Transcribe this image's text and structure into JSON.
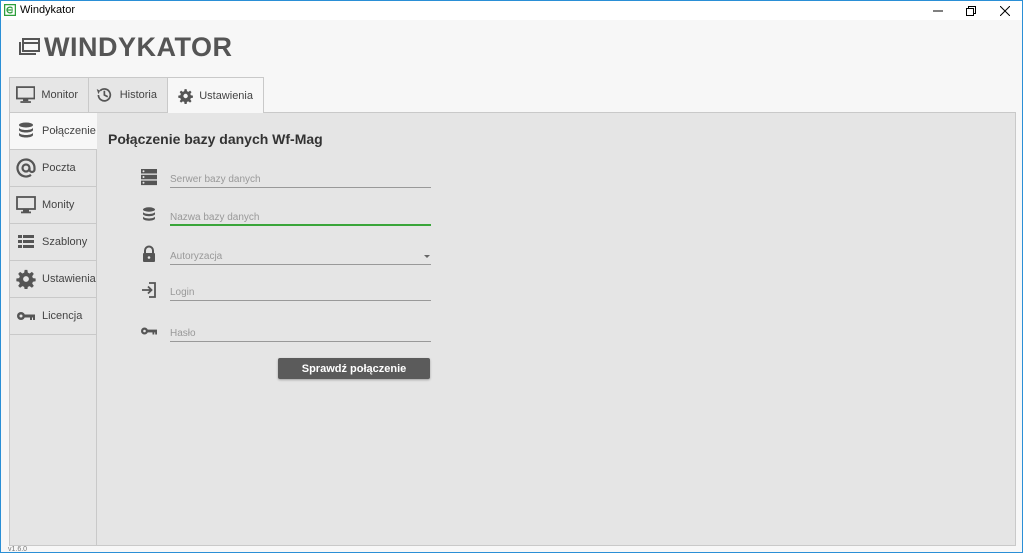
{
  "window": {
    "title": "Windykator"
  },
  "header": {
    "logo_text": "WINDYKATOR"
  },
  "top_tabs": [
    {
      "label": "Monitor",
      "icon": "monitor-icon"
    },
    {
      "label": "Historia",
      "icon": "history-icon"
    },
    {
      "label": "Ustawienia",
      "icon": "gear-icon",
      "active": true
    }
  ],
  "sidebar": {
    "items": [
      {
        "label": "Połączenie",
        "icon": "database-icon",
        "active": true
      },
      {
        "label": "Poczta",
        "icon": "at-icon"
      },
      {
        "label": "Monity",
        "icon": "monitor-icon"
      },
      {
        "label": "Szablony",
        "icon": "list-icon"
      },
      {
        "label": "Ustawienia",
        "icon": "gear-icon"
      },
      {
        "label": "Licencja",
        "icon": "key-icon"
      }
    ]
  },
  "form": {
    "title": "Połączenie bazy danych Wf-Mag",
    "server_placeholder": "Serwer bazy danych",
    "database_placeholder": "Nazwa bazy danych",
    "auth_placeholder": "Autoryzacja",
    "login_placeholder": "Login",
    "password_placeholder": "Hasło",
    "check_button": "Sprawdź połączenie"
  },
  "footer": {
    "version": "v1.6.0"
  },
  "colors": {
    "accent_focus": "#3aa53a",
    "button_bg": "#5b5b5b",
    "window_border": "#2a8fd6",
    "app_icon": "#2e9e3c"
  }
}
